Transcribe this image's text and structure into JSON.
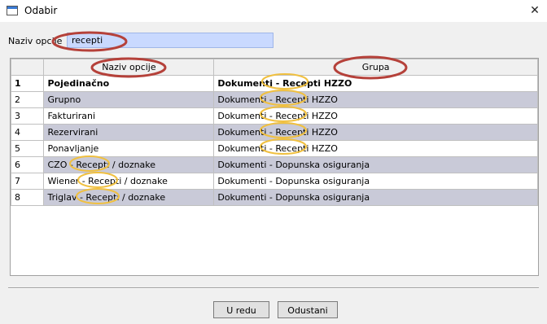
{
  "window": {
    "title": "Odabir",
    "close": "✕"
  },
  "search": {
    "label": "Naziv opcije",
    "value": "recepti"
  },
  "table": {
    "headers": [
      "",
      "Naziv opcije",
      "Grupa"
    ],
    "rows": [
      [
        "1",
        "Pojedinačno",
        "Dokumenti - Recepti HZZO"
      ],
      [
        "2",
        "Grupno",
        "Dokumenti - Recepti HZZO"
      ],
      [
        "3",
        "Fakturirani",
        "Dokumenti - Recepti HZZO"
      ],
      [
        "4",
        "Rezervirani",
        "Dokumenti - Recepti HZZO"
      ],
      [
        "5",
        "Ponavljanje",
        "Dokumenti - Recepti HZZO"
      ],
      [
        "6",
        "CZO - Recepti / doznake",
        "Dokumenti - Dopunska osiguranja"
      ],
      [
        "7",
        "Wiener - Recepti / doznake",
        "Dokumenti - Dopunska osiguranja"
      ],
      [
        "8",
        "Triglav - Recepti / doznake",
        "Dokumenti - Dopunska osiguranja"
      ]
    ]
  },
  "buttons": {
    "ok": "U redu",
    "cancel": "Odustani"
  },
  "colors": {
    "accent": "#c9d9ff",
    "annotation_red": "#b5413a",
    "annotation_yellow": "#f0c040"
  }
}
